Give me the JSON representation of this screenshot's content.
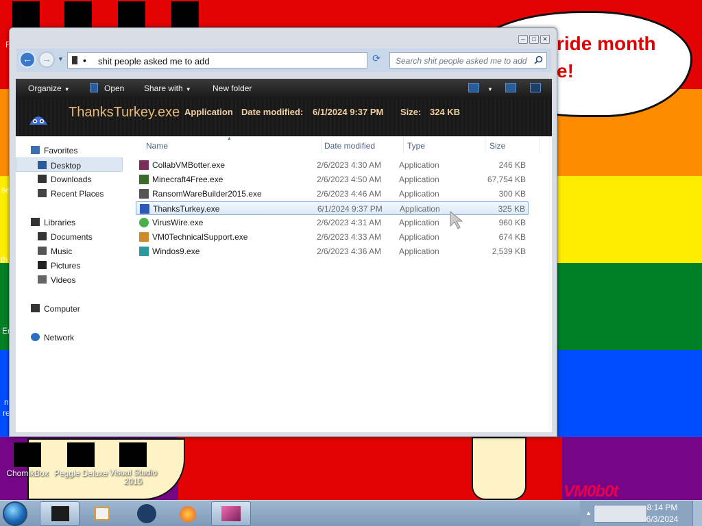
{
  "desktop": {
    "bubble_lines": [
      "ride month",
      "e!"
    ],
    "edge_texts": [
      "F",
      "th",
      "se",
      "Er",
      "n",
      "re"
    ],
    "watermark": "VM0b0t",
    "icons": [
      {
        "label": "ChomikBox"
      },
      {
        "label": "Peggle Deluxe"
      },
      {
        "label": "Visual Studio 2015"
      }
    ]
  },
  "window": {
    "controls": [
      "minimize",
      "maximize",
      "close"
    ],
    "address": {
      "path": "shit people asked me to add",
      "search_placeholder": "Search shit people asked me to add"
    },
    "toolbar": {
      "organize": "Organize",
      "open": "Open",
      "share_with": "Share with",
      "new_folder": "New folder"
    },
    "details": {
      "name": "ThanksTurkey.exe",
      "type": "Application",
      "modified_label": "Date modified:",
      "modified": "6/1/2024 9:37 PM",
      "size_label": "Size:",
      "size": "324 KB"
    },
    "nav": {
      "favorites": "Favorites",
      "desktop": "Desktop",
      "downloads": "Downloads",
      "recent_places": "Recent Places",
      "libraries": "Libraries",
      "documents": "Documents",
      "music": "Music",
      "pictures": "Pictures",
      "videos": "Videos",
      "computer": "Computer",
      "network": "Network"
    },
    "columns": {
      "name": "Name",
      "date_modified": "Date modified",
      "type": "Type",
      "size": "Size"
    },
    "files": [
      {
        "name": "CollabVMBotter.exe",
        "date": "2/6/2023 4:30 AM",
        "type": "Application",
        "size": "246 KB",
        "color": "#7a2e5a"
      },
      {
        "name": "Minecraft4Free.exe",
        "date": "2/6/2023 4:50 AM",
        "type": "Application",
        "size": "67,754 KB",
        "color": "#3b6b2a"
      },
      {
        "name": "RansomWareBuilder2015.exe",
        "date": "2/6/2023 4:46 AM",
        "type": "Application",
        "size": "300 KB",
        "color": "#555555"
      },
      {
        "name": "ThanksTurkey.exe",
        "date": "6/1/2024 9:37 PM",
        "type": "Application",
        "size": "325 KB",
        "color": "#2c58b8"
      },
      {
        "name": "VirusWire.exe",
        "date": "2/6/2023 4:31 AM",
        "type": "Application",
        "size": "960 KB",
        "color": "#4bb04b"
      },
      {
        "name": "VM0TechnicalSupport.exe",
        "date": "2/6/2023 4:33 AM",
        "type": "Application",
        "size": "674 KB",
        "color": "#d08a2a"
      },
      {
        "name": "Windos9.exe",
        "date": "2/6/2023 4:36 AM",
        "type": "Application",
        "size": "2,539 KB",
        "color": "#2a9aa0"
      }
    ]
  },
  "taskbar": {
    "time": "8:14 PM",
    "date": "6/3/2024"
  }
}
